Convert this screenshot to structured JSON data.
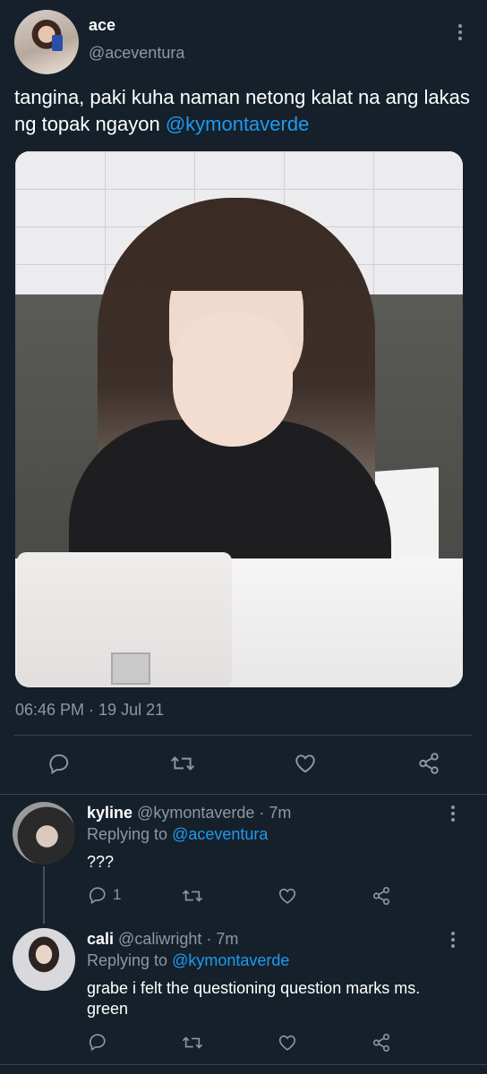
{
  "main_tweet": {
    "display_name": "ace",
    "handle": "@aceventura",
    "text": "tangina, paki kuha naman netong kalat na ang lakas ng topak ngayon ",
    "mention": "@kymontaverde",
    "timestamp": "06:46 PM · 19 Jul 21",
    "actions": {
      "reply_icon": "reply-icon",
      "retweet_icon": "retweet-icon",
      "like_icon": "heart-icon",
      "share_icon": "share-icon"
    }
  },
  "replies": [
    {
      "display_name": "kyline",
      "handle": "@kymontaverde",
      "time": " · 7m",
      "replying_prefix": "Replying to ",
      "replying_to": "@aceventura",
      "text": "???",
      "reply_count": "1"
    },
    {
      "display_name": "cali",
      "handle": "@caliwright",
      "time": " · 7m",
      "replying_prefix": "Replying to ",
      "replying_to": "@kymontaverde",
      "text": "grabe i felt the questioning question marks ms. green",
      "reply_count": ""
    }
  ],
  "colors": {
    "background": "#15202b",
    "accent": "#1d9bf0",
    "muted": "#8b98a5",
    "divider": "#38444d"
  }
}
